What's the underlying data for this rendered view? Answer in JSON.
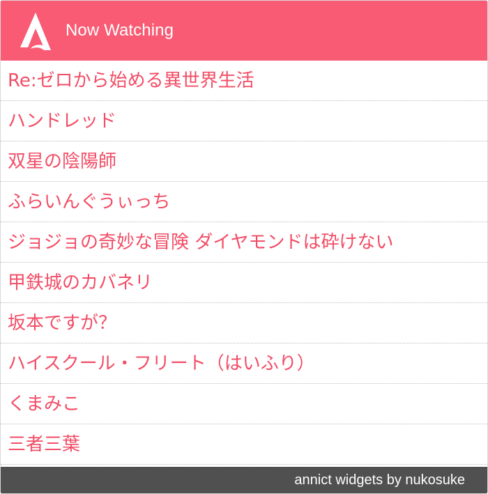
{
  "header": {
    "title": "Now Watching",
    "logo_icon": "annict-logo-icon",
    "background": "#f85b73"
  },
  "items": [
    {
      "title": "Re:ゼロから始める異世界生活"
    },
    {
      "title": "ハンドレッド"
    },
    {
      "title": "双星の陰陽師"
    },
    {
      "title": "ふらいんぐうぃっち"
    },
    {
      "title": "ジョジョの奇妙な冒険 ダイヤモンドは砕けない"
    },
    {
      "title": "甲鉄城のカバネリ"
    },
    {
      "title": "坂本ですが？"
    },
    {
      "title": "ハイスクール・フリート（はいふり）"
    },
    {
      "title": "くまみこ"
    },
    {
      "title": "三者三葉"
    }
  ],
  "footer": {
    "credit": "annict widgets by nukosuke",
    "background": "#505050"
  },
  "colors": {
    "accent": "#f85b73",
    "item_text": "#f24d66"
  }
}
